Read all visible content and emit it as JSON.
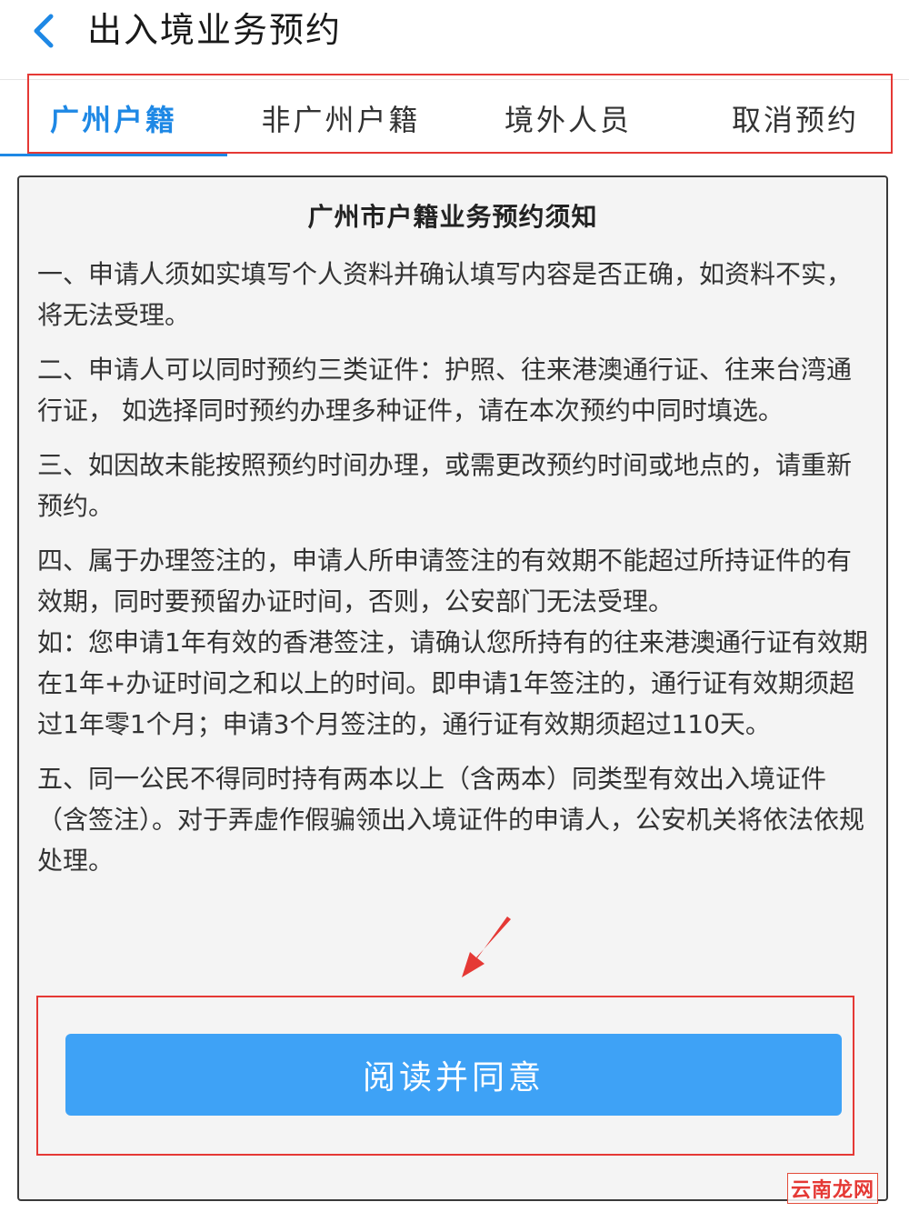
{
  "header": {
    "title": "出入境业务预约"
  },
  "tabs": [
    {
      "label": "广州户籍",
      "active": true
    },
    {
      "label": "非广州户籍",
      "active": false
    },
    {
      "label": "境外人员",
      "active": false
    },
    {
      "label": "取消预约",
      "active": false
    }
  ],
  "notice": {
    "title": "广州市户籍业务预约须知",
    "items": [
      "一、申请人须如实填写个人资料并确认填写内容是否正确，如资料不实，将无法受理。",
      "二、申请人可以同时预约三类证件：护照、往来港澳通行证、往来台湾通行证， 如选择同时预约办理多种证件，请在本次预约中同时填选。",
      "三、如因故未能按照预约时间办理，或需更改预约时间或地点的，请重新预约。",
      "四、属于办理签注的，申请人所申请签注的有效期不能超过所持证件的有效期，同时要预留办证时间，否则，公安部门无法受理。",
      "如：您申请1年有效的香港签注，请确认您所持有的往来港澳通行证有效期在1年+办证时间之和以上的时间。即申请1年签注的，通行证有效期须超过1年零1个月；申请3个月签注的，通行证有效期须超过110天。",
      "五、同一公民不得同时持有两本以上（含两本）同类型有效出入境证件（含签注）。对于弄虚作假骗领出入境证件的申请人，公安机关将依法依规处理。"
    ]
  },
  "agree_button": {
    "label": "阅读并同意"
  },
  "watermark": {
    "text": "云南龙网"
  },
  "colors": {
    "accent": "#1e88e5",
    "button": "#3ea2f6",
    "highlight_box": "#e53935"
  },
  "icons": {
    "back": "chevron-left-icon",
    "annotation": "red-arrow-icon"
  }
}
